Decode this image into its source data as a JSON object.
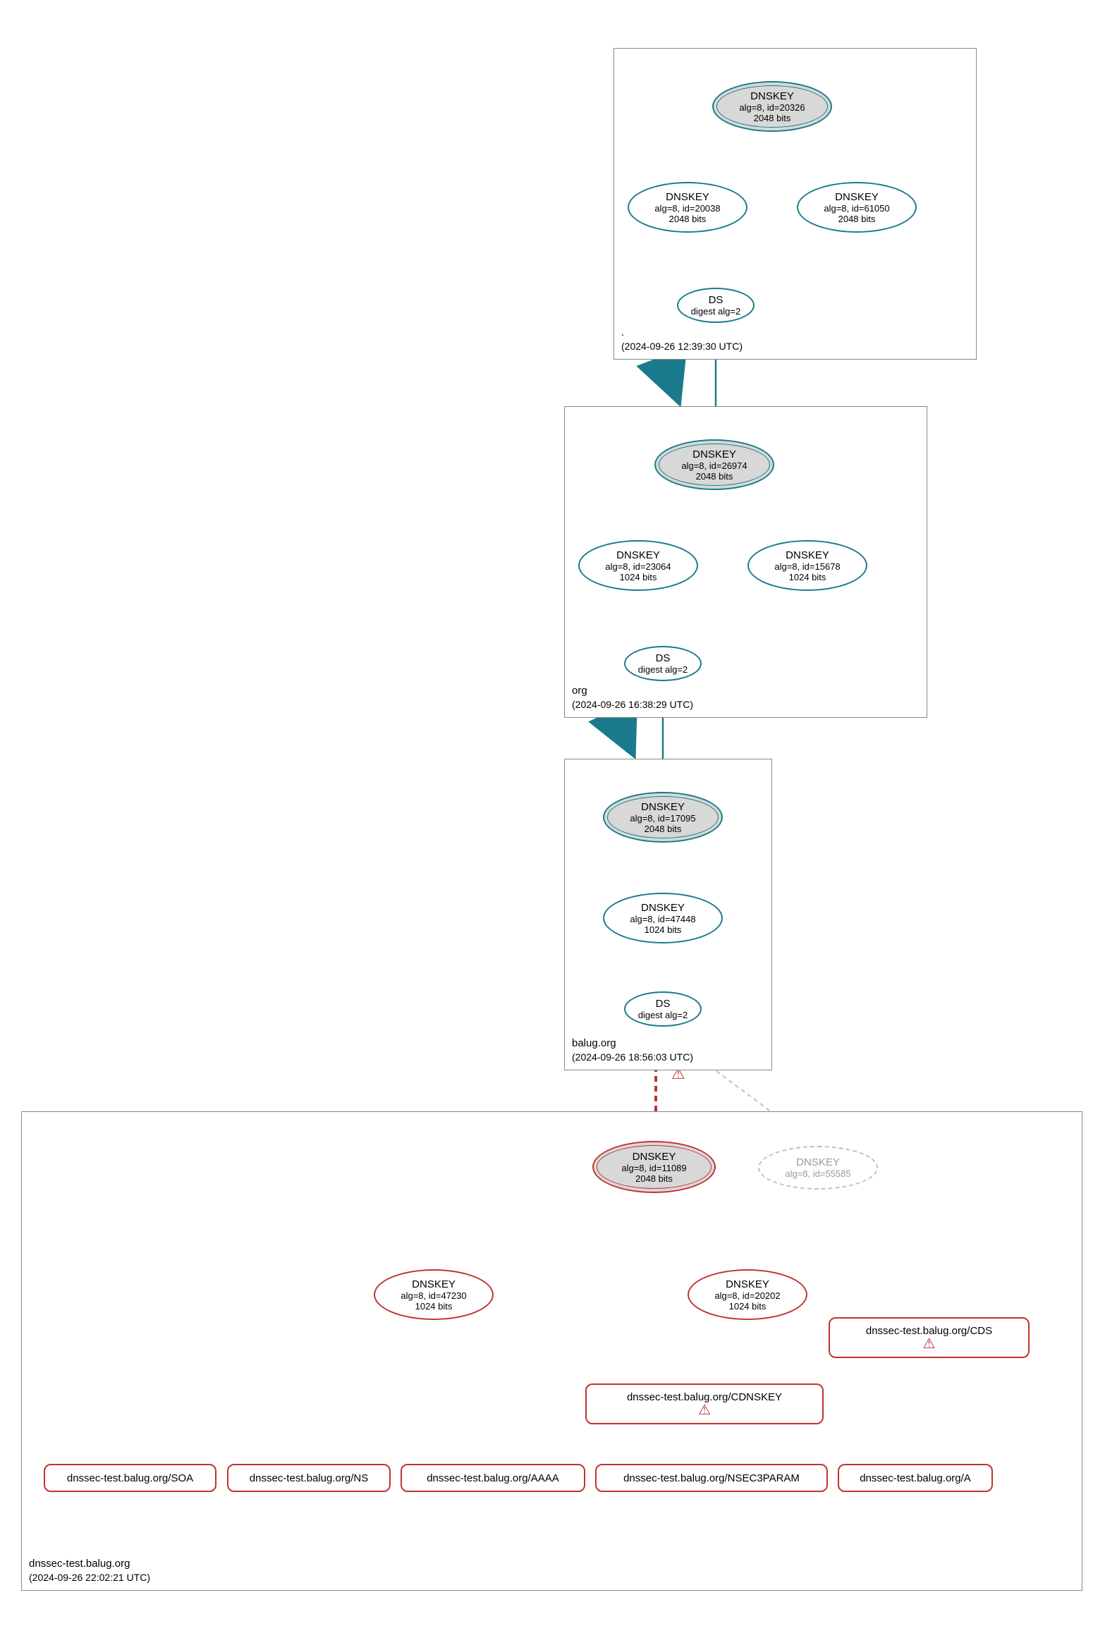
{
  "zones": {
    "root": {
      "name": ".",
      "timestamp": "(2024-09-26 12:39:30 UTC)",
      "ksk": {
        "title": "DNSKEY",
        "meta1": "alg=8, id=20326",
        "meta2": "2048 bits"
      },
      "zsk1": {
        "title": "DNSKEY",
        "meta1": "alg=8, id=20038",
        "meta2": "2048 bits"
      },
      "zsk2": {
        "title": "DNSKEY",
        "meta1": "alg=8, id=61050",
        "meta2": "2048 bits"
      },
      "ds": {
        "title": "DS",
        "meta1": "digest alg=2"
      }
    },
    "org": {
      "name": "org",
      "timestamp": "(2024-09-26 16:38:29 UTC)",
      "ksk": {
        "title": "DNSKEY",
        "meta1": "alg=8, id=26974",
        "meta2": "2048 bits"
      },
      "zsk1": {
        "title": "DNSKEY",
        "meta1": "alg=8, id=23064",
        "meta2": "1024 bits"
      },
      "zsk2": {
        "title": "DNSKEY",
        "meta1": "alg=8, id=15678",
        "meta2": "1024 bits"
      },
      "ds": {
        "title": "DS",
        "meta1": "digest alg=2"
      }
    },
    "balug": {
      "name": "balug.org",
      "timestamp": "(2024-09-26 18:56:03 UTC)",
      "ksk": {
        "title": "DNSKEY",
        "meta1": "alg=8, id=17095",
        "meta2": "2048 bits"
      },
      "zsk": {
        "title": "DNSKEY",
        "meta1": "alg=8, id=47448",
        "meta2": "1024 bits"
      },
      "ds": {
        "title": "DS",
        "meta1": "digest alg=2"
      }
    },
    "dnssectest": {
      "name": "dnssec-test.balug.org",
      "timestamp": "(2024-09-26 22:02:21 UTC)",
      "ksk": {
        "title": "DNSKEY",
        "meta1": "alg=8, id=11089",
        "meta2": "2048 bits"
      },
      "ghost": {
        "title": "DNSKEY",
        "meta1": "alg=8, id=55585"
      },
      "zsk1": {
        "title": "DNSKEY",
        "meta1": "alg=8, id=47230",
        "meta2": "1024 bits"
      },
      "zsk2": {
        "title": "DNSKEY",
        "meta1": "alg=8, id=20202",
        "meta2": "1024 bits"
      },
      "rr": {
        "soa": "dnssec-test.balug.org/SOA",
        "ns": "dnssec-test.balug.org/NS",
        "aaaa": "dnssec-test.balug.org/AAAA",
        "nsec3param": "dnssec-test.balug.org/NSEC3PARAM",
        "a": "dnssec-test.balug.org/A",
        "cdnskey": "dnssec-test.balug.org/CDNSKEY",
        "cds": "dnssec-test.balug.org/CDS"
      }
    }
  },
  "colors": {
    "secure": "#1a7a8c",
    "error": "#c0332e",
    "ghost": "#bfbfbf"
  },
  "warn_glyph": "⚠"
}
